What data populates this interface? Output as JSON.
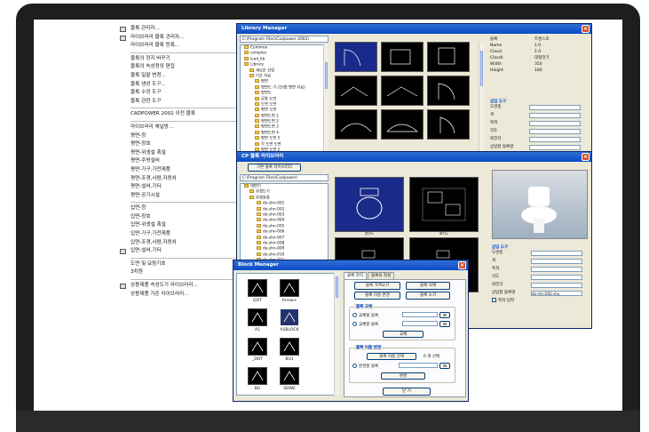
{
  "menu": {
    "items": [
      {
        "label": "블록 관리자...",
        "key": "BM",
        "icon": true
      },
      {
        "label": "라이브러리 블록 관리자...",
        "key": "LM",
        "icon": true
      },
      {
        "label": "라이브러리 블록 등록...",
        "key": "RB",
        "icon": false
      },
      {
        "sep": true
      },
      {
        "label": "블록의 정지 바꾸기",
        "key": "BTM"
      },
      {
        "label": "블록의 속성정의 편집",
        "arrow": true
      },
      {
        "label": "블록 일괄 변경...",
        "key": "BCH"
      },
      {
        "label": "블록 생성 도구...",
        "key": "BMT"
      },
      {
        "label": "블록 수정 도구",
        "arrow": true
      },
      {
        "label": "블록 관련 도구",
        "arrow": true
      },
      {
        "sep": true
      },
      {
        "label": "CADPOWER 2002 이전 블록",
        "arrow": true
      },
      {
        "sep": true
      },
      {
        "label": "라이브러리 채널방...",
        "arrow": true
      },
      {
        "label": "평면-창",
        "arrow": true
      },
      {
        "label": "평면-창호",
        "arrow": true
      },
      {
        "label": "평면-위생설 폭설",
        "arrow": true
      },
      {
        "label": "평면-주방설비",
        "arrow": true
      },
      {
        "label": "평면-가구,가전제품",
        "arrow": true
      },
      {
        "label": "평면-조경,사람,자동차",
        "arrow": true
      },
      {
        "label": "평면-설비,기타",
        "arrow": true
      },
      {
        "label": "평면-공기시설",
        "arrow": true
      },
      {
        "sep": true
      },
      {
        "label": "입면-창",
        "arrow": true
      },
      {
        "label": "입면-창호",
        "arrow": true
      },
      {
        "label": "입면-위생설 폭설",
        "arrow": true
      },
      {
        "label": "입면-가구,가전제품",
        "arrow": true
      },
      {
        "label": "입면-조경,사람,자동차",
        "arrow": true
      },
      {
        "label": "입면-설비,기타",
        "icon": true
      },
      {
        "sep": true
      },
      {
        "label": "도면 및 요람기호",
        "arrow": true
      },
      {
        "label": "3차원",
        "arrow": true
      },
      {
        "sep": true
      },
      {
        "label": "상용제품 속성도기 라이브러리...",
        "key": "BLM",
        "icon": true
      },
      {
        "label": "상용제품 기존 라이브러리...",
        "key": "ESS"
      }
    ]
  },
  "library_manager": {
    "title": "Library Manager",
    "path": "C:\\Program Files\\Cadpower 2002\\",
    "tree": [
      "Common",
      "complex",
      "lcad_lib",
      "Library",
      "새로운 산업",
      "기초 자료",
      "평면",
      "평면도 기 (10층 평면 자료)",
      "평면도",
      "공통 도면",
      "도면 도면",
      "평면 도면",
      "평면도면 1",
      "평면도면 2",
      "평면도면 3",
      "평면도면 4",
      "평면 도면 5",
      "각 도면 도면 ",
      "평면 도면 2",
      "기타 도면",
      "도면 도면",
      "상세 설명",
      "기타 기타"
    ],
    "props": [
      {
        "k": "블록",
        "v": "트랜스포"
      },
      {
        "k": "Name",
        "v": "1.0"
      },
      {
        "k": "ClassI",
        "v": "1.0"
      },
      {
        "k": "ClassII",
        "v": "대형전기"
      },
      {
        "k": "Width",
        "v": "350"
      },
      {
        "k": "Height",
        "v": "180"
      }
    ],
    "insert_group": "삽입 도구",
    "insert_rows": [
      "도면층",
      "색",
      "축척",
      "각도",
      "회전각",
      "삽입할 블록명"
    ]
  },
  "cp_window": {
    "title": "CP 블록 라이브러리",
    "tab": "기본 블록 라이브러리",
    "path": "C:\\Program Files\\Cadpower\\",
    "tree": [
      "대변기",
      "위생도기",
      "위생용품",
      "de-shn-001",
      "de-shn-002",
      "de-shn-003",
      "de-shn-004",
      "de-shn-005",
      "de-shn-006",
      "de-shn-007",
      "de-shn-008",
      "de-shn-009",
      "de-shn-010",
      "de-shn-011"
    ],
    "thumb_labels": [
      "평면도",
      "배치도",
      "",
      ""
    ],
    "insert_group": "삽입 도구",
    "insert_block": "de-shn-002-shu",
    "rows": [
      "도면층",
      "색",
      "축척",
      "각도",
      "회전각",
      "삽입할 블록명"
    ],
    "checkbox": "축척 입력"
  },
  "block_manager": {
    "title": "Block Manager",
    "blocks": [
      "DOT",
      "Arrow+",
      "A1",
      "A1BLOCK",
      "_DOT",
      "BU1",
      "BU",
      "SDWE"
    ],
    "tabs": [
      "블록 관리",
      "블록의 작성"
    ],
    "buttons": [
      "블록 가져오기",
      "블록 삭제",
      "블록 이름 변경",
      "블록 소거"
    ],
    "group1": "블록 교체",
    "radio1": "교체될 블록",
    "radio2": "교체할 블록",
    "replace_btn": "교체",
    "group2": "블록 이름 변경",
    "select_btn": "블록 이름 선택",
    "count": "0 개 선택",
    "radio3": "변경할 블록",
    "change_btn": "변경",
    "close_btn": "닫 기"
  }
}
